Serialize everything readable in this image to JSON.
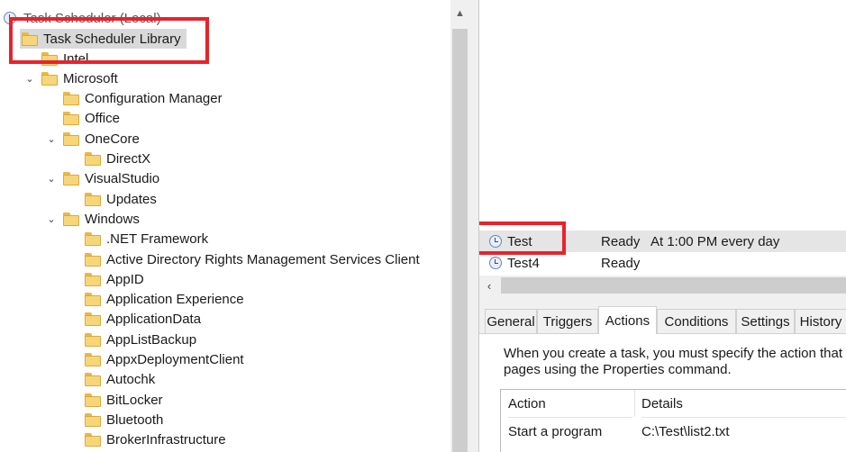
{
  "tree": {
    "root_label": "Task Scheduler (Local)",
    "library_label": "Task Scheduler Library",
    "items": [
      {
        "label": "Intel",
        "depth": 1,
        "expanded": null
      },
      {
        "label": "Microsoft",
        "depth": 1,
        "expanded": true
      },
      {
        "label": "Configuration Manager",
        "depth": 2,
        "expanded": null
      },
      {
        "label": "Office",
        "depth": 2,
        "expanded": null
      },
      {
        "label": "OneCore",
        "depth": 2,
        "expanded": true
      },
      {
        "label": "DirectX",
        "depth": 3,
        "expanded": null
      },
      {
        "label": "VisualStudio",
        "depth": 2,
        "expanded": true
      },
      {
        "label": "Updates",
        "depth": 3,
        "expanded": null
      },
      {
        "label": "Windows",
        "depth": 2,
        "expanded": true
      },
      {
        "label": ".NET Framework",
        "depth": 3,
        "expanded": null
      },
      {
        "label": "Active Directory Rights Management Services Client",
        "depth": 3,
        "expanded": null
      },
      {
        "label": "AppID",
        "depth": 3,
        "expanded": null
      },
      {
        "label": "Application Experience",
        "depth": 3,
        "expanded": null
      },
      {
        "label": "ApplicationData",
        "depth": 3,
        "expanded": null
      },
      {
        "label": "AppListBackup",
        "depth": 3,
        "expanded": null
      },
      {
        "label": "AppxDeploymentClient",
        "depth": 3,
        "expanded": null
      },
      {
        "label": "Autochk",
        "depth": 3,
        "expanded": null
      },
      {
        "label": "BitLocker",
        "depth": 3,
        "expanded": null
      },
      {
        "label": "Bluetooth",
        "depth": 3,
        "expanded": null
      },
      {
        "label": "BrokerInfrastructure",
        "depth": 3,
        "expanded": null
      }
    ]
  },
  "tasks": [
    {
      "name": "Test",
      "status": "Ready",
      "trigger": "At 1:00 PM every day"
    },
    {
      "name": "Test4",
      "status": "Ready",
      "trigger": ""
    }
  ],
  "tabs": [
    "General",
    "Triggers",
    "Actions",
    "Conditions",
    "Settings",
    "History"
  ],
  "active_tab": "Actions",
  "actions_panel": {
    "description_line1": "When you create a task, you must specify the action that w",
    "description_line2": "pages using the Properties command.",
    "columns": [
      "Action",
      "Details"
    ],
    "rows": [
      {
        "action": "Start a program",
        "details": "C:\\Test\\list2.txt"
      }
    ]
  },
  "highlight_color": "#e8222c"
}
